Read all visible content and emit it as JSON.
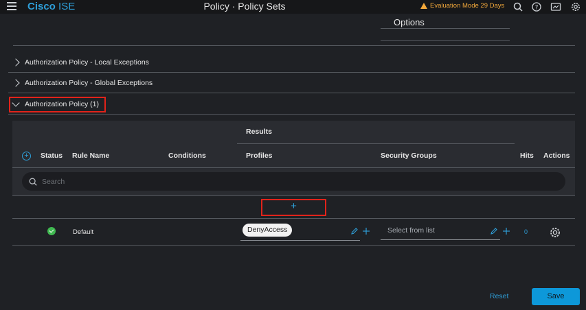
{
  "header": {
    "brand_bold": "Cisco",
    "brand_rest": "ISE",
    "title": "Policy · Policy Sets",
    "eval_text": "Evaluation Mode 29 Days",
    "icons": [
      "search-icon",
      "help-icon",
      "dashboard-icon",
      "gear-icon"
    ]
  },
  "options_label": "Options",
  "sections": [
    {
      "label": "Authorization Policy - Local Exceptions",
      "expanded": false
    },
    {
      "label": "Authorization Policy - Global Exceptions",
      "expanded": false
    },
    {
      "label": "Authorization Policy (1)",
      "expanded": true
    }
  ],
  "table": {
    "results_header": "Results",
    "columns": {
      "status": "Status",
      "rule_name": "Rule Name",
      "conditions": "Conditions",
      "profiles": "Profiles",
      "security_groups": "Security Groups",
      "hits": "Hits",
      "actions": "Actions"
    },
    "search_placeholder": "Search",
    "add_row_glyph": "+",
    "rows": [
      {
        "status": "enabled",
        "rule_name": "Default",
        "profile": "DenyAccess",
        "security_group_placeholder": "Select from list",
        "hits": "0"
      }
    ]
  },
  "footer": {
    "reset_label": "Reset",
    "save_label": "Save"
  },
  "colors": {
    "accent": "#2e9fd9",
    "warning": "#f2a83b",
    "highlight": "#e2231a",
    "success": "#3fb950",
    "save_bg": "#0d98d9"
  }
}
